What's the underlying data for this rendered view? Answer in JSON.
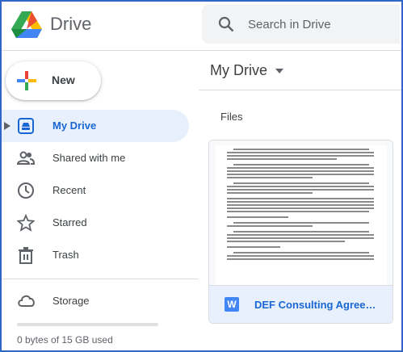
{
  "header": {
    "brand": "Drive",
    "search_placeholder": "Search in Drive"
  },
  "sidebar": {
    "new_label": "New",
    "items": [
      {
        "label": "My Drive",
        "icon": "my-drive-icon",
        "active": true
      },
      {
        "label": "Shared with me",
        "icon": "shared-icon",
        "active": false
      },
      {
        "label": "Recent",
        "icon": "clock-icon",
        "active": false
      },
      {
        "label": "Starred",
        "icon": "star-icon",
        "active": false
      },
      {
        "label": "Trash",
        "icon": "trash-icon",
        "active": false
      }
    ],
    "storage_label": "Storage",
    "storage_text": "0 bytes of 15 GB used"
  },
  "main": {
    "title": "My Drive",
    "section": "Files",
    "files": [
      {
        "name": "DEF Consulting Agreeme...",
        "icon": "word-doc-icon",
        "icon_letter": "W"
      }
    ]
  },
  "colors": {
    "accent": "#1967d2",
    "active_bg": "#e8f0fe",
    "search_bg": "#f1f3f4",
    "frame": "#2f66c8"
  }
}
